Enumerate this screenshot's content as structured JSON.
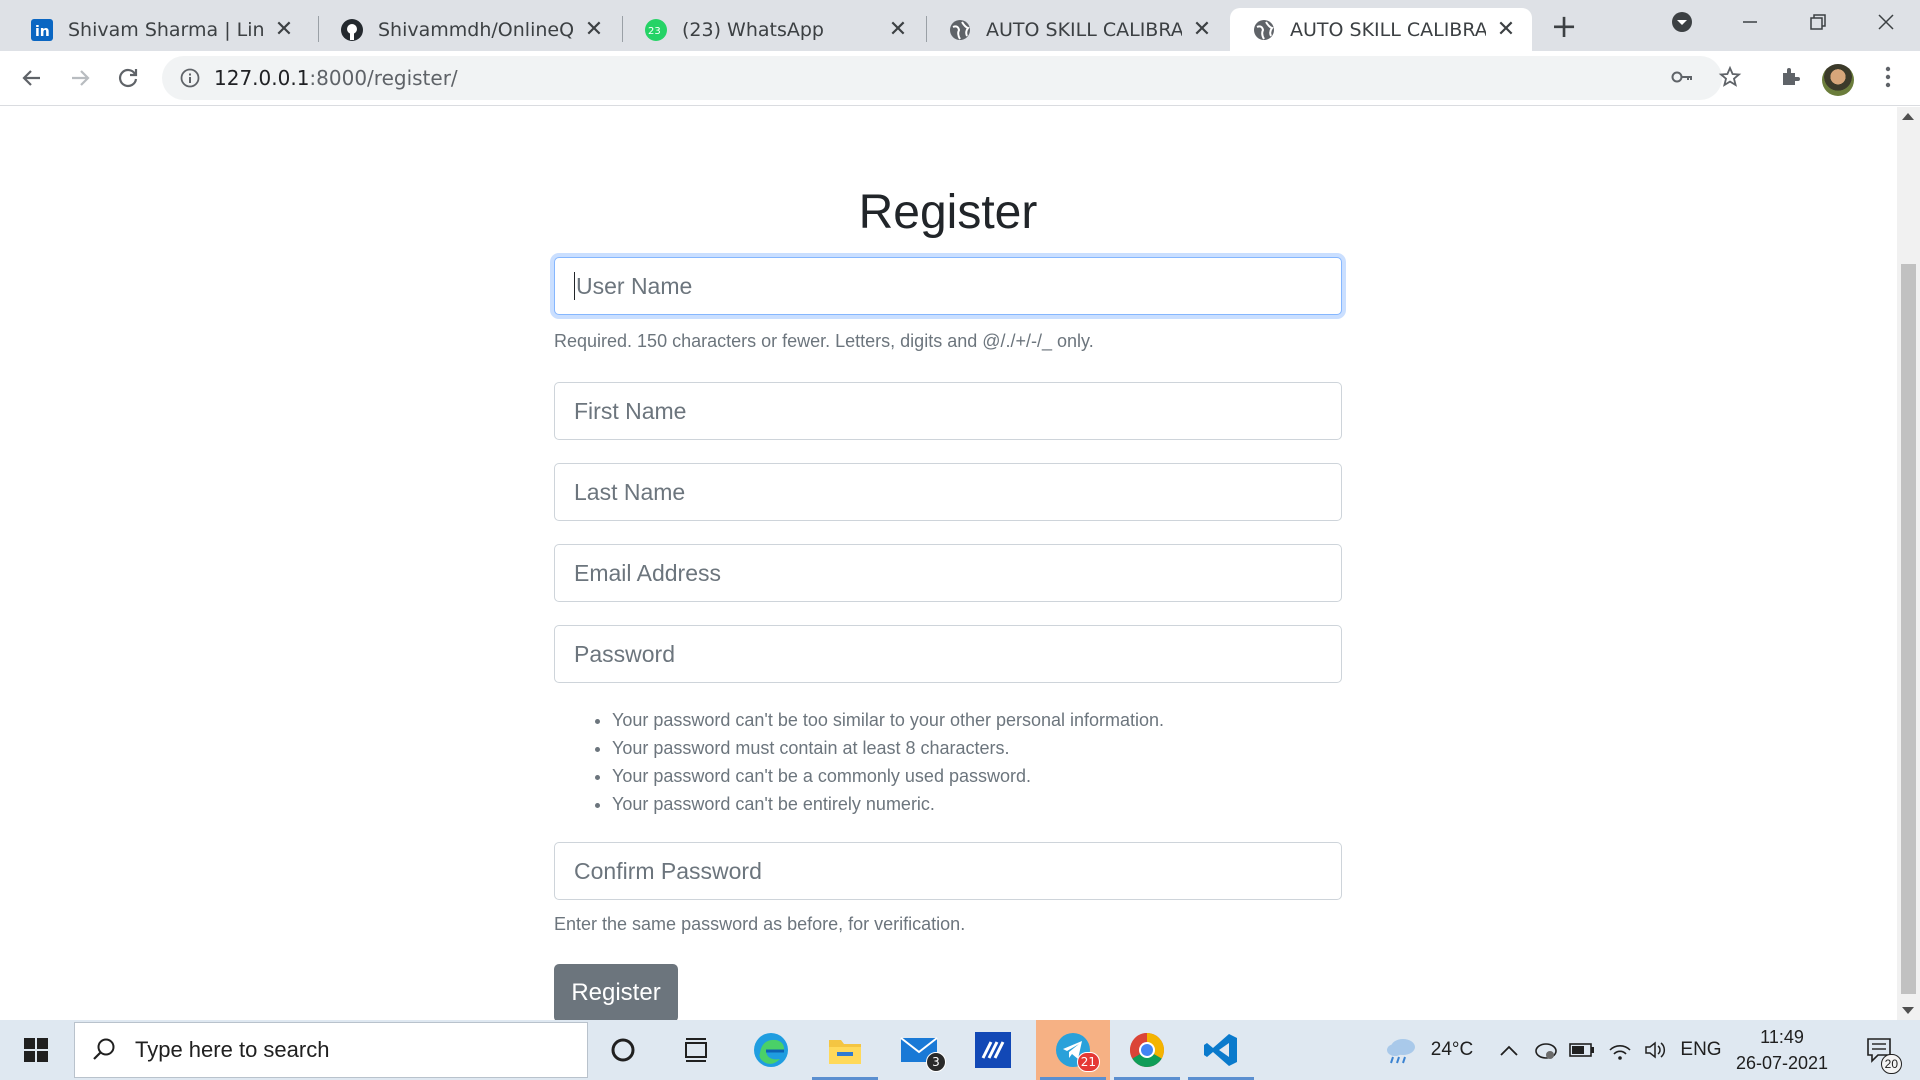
{
  "browser": {
    "tabs": [
      {
        "title": "Shivam Sharma | LinkedIn",
        "icon": "linkedin-icon"
      },
      {
        "title": "Shivammdh/OnlineQuizeS",
        "icon": "github-icon"
      },
      {
        "title": "(23) WhatsApp",
        "icon": "whatsapp-icon",
        "badge": "23"
      },
      {
        "title": "AUTO SKILL CALIBRATOR",
        "icon": "globe-icon"
      },
      {
        "title": "AUTO SKILL CALIBRATOR",
        "icon": "globe-icon",
        "active": true
      }
    ],
    "url_host": "127.0.0.1",
    "url_path": ":8000/register/"
  },
  "page": {
    "heading": "Register",
    "username_placeholder": "User Name",
    "username_help": "Required. 150 characters or fewer. Letters, digits and @/./+/-/_ only.",
    "first_name_placeholder": "First Name",
    "last_name_placeholder": "Last Name",
    "email_placeholder": "Email Address",
    "password_placeholder": "Password",
    "password_rules": [
      "Your password can't be too similar to your other personal information.",
      "Your password must contain at least 8 characters.",
      "Your password can't be a commonly used password.",
      "Your password can't be entirely numeric."
    ],
    "confirm_placeholder": "Confirm Password",
    "confirm_help": "Enter the same password as before, for verification.",
    "submit_label": "Register"
  },
  "taskbar": {
    "search_placeholder": "Type here to search",
    "mail_badge": "3",
    "telegram_badge": "21",
    "temperature": "24°C",
    "language": "ENG",
    "time": "11:49",
    "date": "26-07-2021",
    "notifications": "20"
  },
  "colors": {
    "linkedin": "#0a66c2",
    "whatsapp": "#25d366",
    "button": "#6c757d",
    "focus_border": "#86b7fe"
  }
}
